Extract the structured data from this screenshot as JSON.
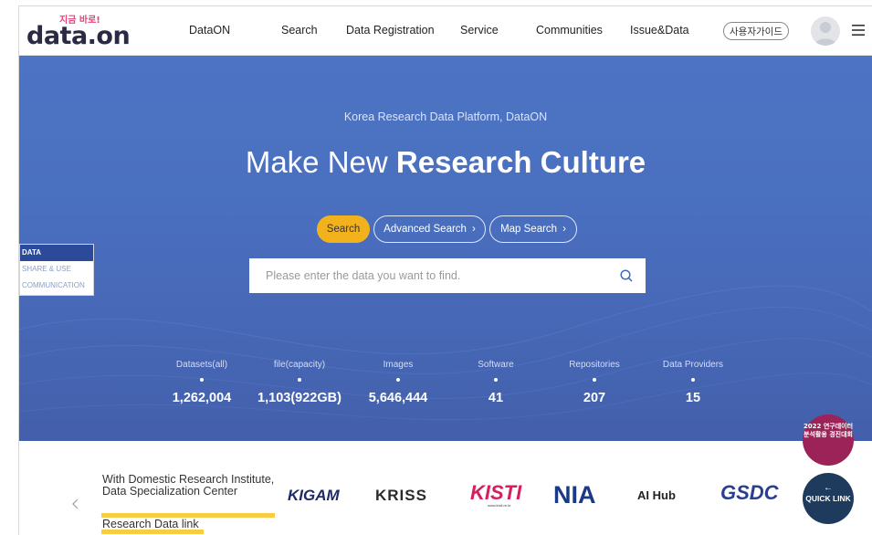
{
  "header": {
    "logo_tag": "지금 바로!",
    "logo_text": "data.on",
    "nav": [
      "DataON",
      "Search",
      "Data Registration",
      "Service",
      "Communities",
      "Issue&Data"
    ],
    "guide_label": "사용자가이드"
  },
  "hero": {
    "subtitle": "Korea Research Data Platform, DataON",
    "headline_light": "Make New ",
    "headline_bold": "Research Culture",
    "buttons": {
      "search": "Search",
      "advanced": "Advanced Search",
      "map": "Map Search"
    },
    "search_placeholder": "Please enter the data you want to find.",
    "stats": [
      {
        "label": "Datasets(all)",
        "value": "1,262,004"
      },
      {
        "label": "file(capacity)",
        "value": "1,103(922GB)"
      },
      {
        "label": "Images",
        "value": "5,646,444"
      },
      {
        "label": "Software",
        "value": "41"
      },
      {
        "label": "Repositories",
        "value": "207"
      },
      {
        "label": "Data Providers",
        "value": "15"
      }
    ]
  },
  "side_widget": [
    "DATA",
    "SHARE & USE",
    "COMMUNICATION"
  ],
  "partners": {
    "heading": "With Domestic Research Institute, Data Specialization Center",
    "link": "Research Data link",
    "logos": [
      "KIGAM",
      "KRISS",
      "KISTI",
      "NIA",
      "AI Hub",
      "GSDC"
    ],
    "kisti_sub": "www.kisti.re.kr"
  },
  "floating": {
    "badge_text": "2022 연구데이터 분석활용 경진대회",
    "quick_link": "QUICK LINK"
  },
  "colors": {
    "hero_blue": "#4a6fbf",
    "search_accent": "#f2b21e",
    "side_active": "#2c4a9a",
    "badge": "#9b2358",
    "quick_link": "#1e3a5c"
  }
}
